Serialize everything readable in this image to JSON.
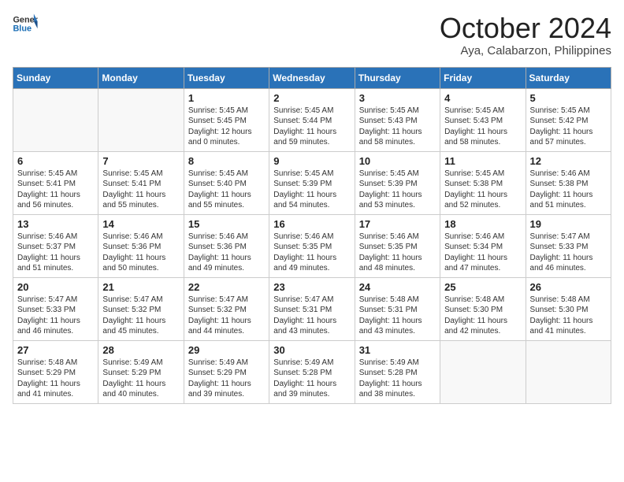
{
  "header": {
    "logo_line1": "General",
    "logo_line2": "Blue",
    "month": "October 2024",
    "location": "Aya, Calabarzon, Philippines"
  },
  "weekdays": [
    "Sunday",
    "Monday",
    "Tuesday",
    "Wednesday",
    "Thursday",
    "Friday",
    "Saturday"
  ],
  "weeks": [
    [
      {
        "day": "",
        "empty": true
      },
      {
        "day": "",
        "empty": true
      },
      {
        "day": "1",
        "sunrise": "Sunrise: 5:45 AM",
        "sunset": "Sunset: 5:45 PM",
        "daylight": "Daylight: 12 hours and 0 minutes."
      },
      {
        "day": "2",
        "sunrise": "Sunrise: 5:45 AM",
        "sunset": "Sunset: 5:44 PM",
        "daylight": "Daylight: 11 hours and 59 minutes."
      },
      {
        "day": "3",
        "sunrise": "Sunrise: 5:45 AM",
        "sunset": "Sunset: 5:43 PM",
        "daylight": "Daylight: 11 hours and 58 minutes."
      },
      {
        "day": "4",
        "sunrise": "Sunrise: 5:45 AM",
        "sunset": "Sunset: 5:43 PM",
        "daylight": "Daylight: 11 hours and 58 minutes."
      },
      {
        "day": "5",
        "sunrise": "Sunrise: 5:45 AM",
        "sunset": "Sunset: 5:42 PM",
        "daylight": "Daylight: 11 hours and 57 minutes."
      }
    ],
    [
      {
        "day": "6",
        "sunrise": "Sunrise: 5:45 AM",
        "sunset": "Sunset: 5:41 PM",
        "daylight": "Daylight: 11 hours and 56 minutes."
      },
      {
        "day": "7",
        "sunrise": "Sunrise: 5:45 AM",
        "sunset": "Sunset: 5:41 PM",
        "daylight": "Daylight: 11 hours and 55 minutes."
      },
      {
        "day": "8",
        "sunrise": "Sunrise: 5:45 AM",
        "sunset": "Sunset: 5:40 PM",
        "daylight": "Daylight: 11 hours and 55 minutes."
      },
      {
        "day": "9",
        "sunrise": "Sunrise: 5:45 AM",
        "sunset": "Sunset: 5:39 PM",
        "daylight": "Daylight: 11 hours and 54 minutes."
      },
      {
        "day": "10",
        "sunrise": "Sunrise: 5:45 AM",
        "sunset": "Sunset: 5:39 PM",
        "daylight": "Daylight: 11 hours and 53 minutes."
      },
      {
        "day": "11",
        "sunrise": "Sunrise: 5:45 AM",
        "sunset": "Sunset: 5:38 PM",
        "daylight": "Daylight: 11 hours and 52 minutes."
      },
      {
        "day": "12",
        "sunrise": "Sunrise: 5:46 AM",
        "sunset": "Sunset: 5:38 PM",
        "daylight": "Daylight: 11 hours and 51 minutes."
      }
    ],
    [
      {
        "day": "13",
        "sunrise": "Sunrise: 5:46 AM",
        "sunset": "Sunset: 5:37 PM",
        "daylight": "Daylight: 11 hours and 51 minutes."
      },
      {
        "day": "14",
        "sunrise": "Sunrise: 5:46 AM",
        "sunset": "Sunset: 5:36 PM",
        "daylight": "Daylight: 11 hours and 50 minutes."
      },
      {
        "day": "15",
        "sunrise": "Sunrise: 5:46 AM",
        "sunset": "Sunset: 5:36 PM",
        "daylight": "Daylight: 11 hours and 49 minutes."
      },
      {
        "day": "16",
        "sunrise": "Sunrise: 5:46 AM",
        "sunset": "Sunset: 5:35 PM",
        "daylight": "Daylight: 11 hours and 49 minutes."
      },
      {
        "day": "17",
        "sunrise": "Sunrise: 5:46 AM",
        "sunset": "Sunset: 5:35 PM",
        "daylight": "Daylight: 11 hours and 48 minutes."
      },
      {
        "day": "18",
        "sunrise": "Sunrise: 5:46 AM",
        "sunset": "Sunset: 5:34 PM",
        "daylight": "Daylight: 11 hours and 47 minutes."
      },
      {
        "day": "19",
        "sunrise": "Sunrise: 5:47 AM",
        "sunset": "Sunset: 5:33 PM",
        "daylight": "Daylight: 11 hours and 46 minutes."
      }
    ],
    [
      {
        "day": "20",
        "sunrise": "Sunrise: 5:47 AM",
        "sunset": "Sunset: 5:33 PM",
        "daylight": "Daylight: 11 hours and 46 minutes."
      },
      {
        "day": "21",
        "sunrise": "Sunrise: 5:47 AM",
        "sunset": "Sunset: 5:32 PM",
        "daylight": "Daylight: 11 hours and 45 minutes."
      },
      {
        "day": "22",
        "sunrise": "Sunrise: 5:47 AM",
        "sunset": "Sunset: 5:32 PM",
        "daylight": "Daylight: 11 hours and 44 minutes."
      },
      {
        "day": "23",
        "sunrise": "Sunrise: 5:47 AM",
        "sunset": "Sunset: 5:31 PM",
        "daylight": "Daylight: 11 hours and 43 minutes."
      },
      {
        "day": "24",
        "sunrise": "Sunrise: 5:48 AM",
        "sunset": "Sunset: 5:31 PM",
        "daylight": "Daylight: 11 hours and 43 minutes."
      },
      {
        "day": "25",
        "sunrise": "Sunrise: 5:48 AM",
        "sunset": "Sunset: 5:30 PM",
        "daylight": "Daylight: 11 hours and 42 minutes."
      },
      {
        "day": "26",
        "sunrise": "Sunrise: 5:48 AM",
        "sunset": "Sunset: 5:30 PM",
        "daylight": "Daylight: 11 hours and 41 minutes."
      }
    ],
    [
      {
        "day": "27",
        "sunrise": "Sunrise: 5:48 AM",
        "sunset": "Sunset: 5:29 PM",
        "daylight": "Daylight: 11 hours and 41 minutes."
      },
      {
        "day": "28",
        "sunrise": "Sunrise: 5:49 AM",
        "sunset": "Sunset: 5:29 PM",
        "daylight": "Daylight: 11 hours and 40 minutes."
      },
      {
        "day": "29",
        "sunrise": "Sunrise: 5:49 AM",
        "sunset": "Sunset: 5:29 PM",
        "daylight": "Daylight: 11 hours and 39 minutes."
      },
      {
        "day": "30",
        "sunrise": "Sunrise: 5:49 AM",
        "sunset": "Sunset: 5:28 PM",
        "daylight": "Daylight: 11 hours and 39 minutes."
      },
      {
        "day": "31",
        "sunrise": "Sunrise: 5:49 AM",
        "sunset": "Sunset: 5:28 PM",
        "daylight": "Daylight: 11 hours and 38 minutes."
      },
      {
        "day": "",
        "empty": true
      },
      {
        "day": "",
        "empty": true
      }
    ]
  ]
}
